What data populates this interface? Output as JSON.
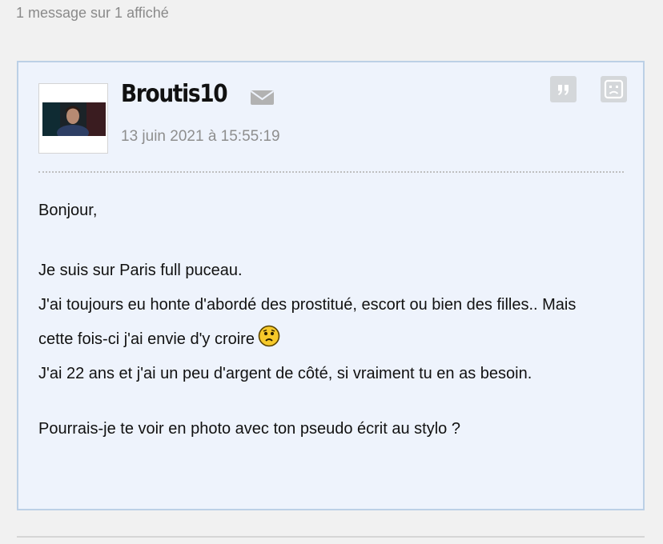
{
  "header": {
    "count_text": "1 message sur 1 affiché"
  },
  "message": {
    "author": "Broutis10",
    "date": "13 juin 2021 à 15:55:19",
    "icons": {
      "mail": "envelope-icon",
      "quote": "quote-icon",
      "report": "sad-face-icon",
      "emoji": "worried-smiley-icon"
    },
    "body": {
      "greeting": "Bonjour,",
      "line1": "Je suis sur Paris full puceau.",
      "line2": "J'ai toujours eu honte d'abordé des prostitué, escort ou bien des filles.. Mais cette fois-ci j'ai envie d'y croire",
      "line3": "J'ai 22 ans et j'ai un peu d'argent de côté, si vraiment tu en as besoin.",
      "line4": "Pourrais-je te voir en photo avec ton pseudo écrit au stylo ?"
    }
  },
  "colors": {
    "page_bg": "#f1f1f1",
    "card_bg": "#eef3fc",
    "card_border": "#bcd0e6",
    "button_bg": "#d4d7da",
    "muted_text": "#8e8e8e"
  }
}
